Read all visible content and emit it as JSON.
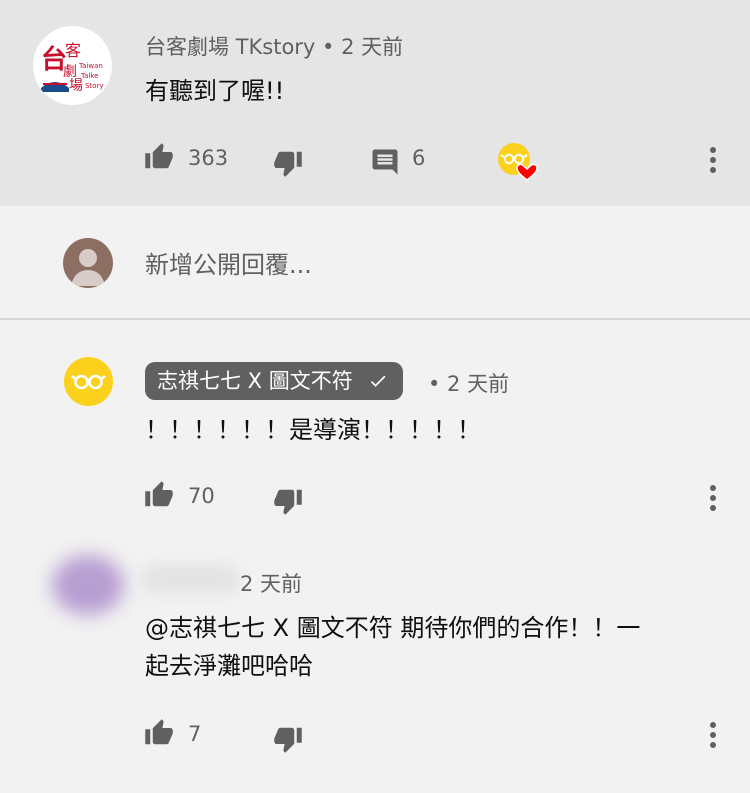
{
  "top_comment": {
    "author": "台客劇場 TKstory",
    "time": "• 2 天前",
    "text": "有聽到了喔!!",
    "likes": "363",
    "replies": "6"
  },
  "reply_box": {
    "placeholder": "新增公開回覆..."
  },
  "reply1": {
    "author": "志祺七七 X 圖文不符",
    "time": "• 2 天前",
    "text": "！！！！！！是導演！！！！！",
    "likes": "70"
  },
  "reply2": {
    "time": "2 天前",
    "text_line1": "@志祺七七 X 圖文不符 期待你們的合作！！一",
    "text_line2": "起去淨灘吧哈哈",
    "likes": "7"
  },
  "logo_text": {
    "line1": "台客",
    "line2": "劇場",
    "en": "Taiwan Talke Story"
  },
  "colors": {
    "highlight_bg": "#e5e5e5",
    "heart": "#ff0000",
    "glasses_avatar": "#fcd11b"
  }
}
